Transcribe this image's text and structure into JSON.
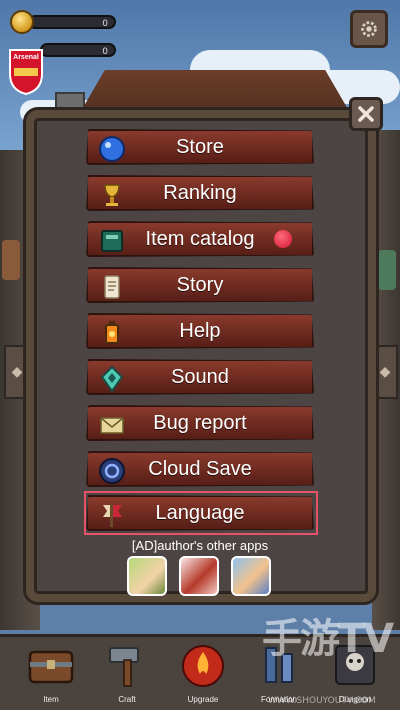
{
  "hud": {
    "coins": "0",
    "gems": "0",
    "badge_text": "Arsenal"
  },
  "menu": {
    "items": [
      {
        "label": "Store",
        "icon": "blue-orb-icon"
      },
      {
        "label": "Ranking",
        "icon": "gold-goblet-icon"
      },
      {
        "label": "Item catalog",
        "icon": "green-book-icon",
        "notification": true
      },
      {
        "label": "Story",
        "icon": "scroll-icon"
      },
      {
        "label": "Help",
        "icon": "lantern-icon"
      },
      {
        "label": "Sound",
        "icon": "teal-crystal-icon"
      },
      {
        "label": "Bug report",
        "icon": "envelope-icon"
      },
      {
        "label": "Cloud Save",
        "icon": "blue-portal-icon"
      },
      {
        "label": "Language",
        "icon": "red-banner-icon",
        "selected": true
      }
    ],
    "ad_label": "[AD]author's other apps"
  },
  "bottom_tabs": [
    {
      "label": "Item",
      "icon": "chest-icon"
    },
    {
      "label": "Craft",
      "icon": "hammer-icon"
    },
    {
      "label": "Upgrade",
      "icon": "fire-orb-icon"
    },
    {
      "label": "Formation",
      "icon": "formation-icon"
    },
    {
      "label": "Dungeon",
      "icon": "skull-gate-icon"
    }
  ],
  "watermark": {
    "text": "手游TV",
    "url": "WWW.SHOUYOUTV.COM"
  },
  "colors": {
    "button": "#6d2a20",
    "selected_outline": "#e6526a",
    "notification": "#d01432",
    "panel": "#4d4543"
  }
}
